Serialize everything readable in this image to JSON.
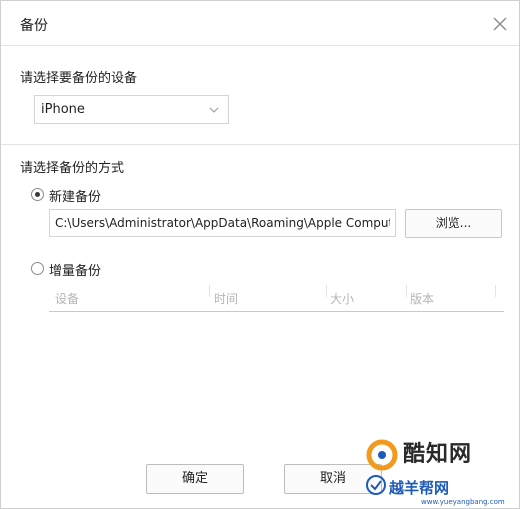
{
  "dialog": {
    "title": "备份",
    "close_icon": "close-icon"
  },
  "device_section": {
    "label": "请选择要备份的设备",
    "selected_device": "iPhone",
    "arrow_icon": "chevron-down-icon"
  },
  "method_section": {
    "label": "请选择备份的方式",
    "new_backup": {
      "label": "新建备份",
      "checked": true,
      "path_value": "C:\\Users\\Administrator\\AppData\\Roaming\\Apple Computer\\MobileSync\\Backup",
      "browse_label": "浏览..."
    },
    "incremental_backup": {
      "label": "增量备份",
      "checked": false,
      "columns": [
        "设备",
        "时间",
        "大小",
        "版本"
      ]
    }
  },
  "footer": {
    "ok_label": "确定",
    "cancel_label": "取消"
  },
  "watermark": {
    "brand1": "酷知网",
    "brand2": "越羊帮网",
    "url": "www.yueyangbang.com"
  },
  "colors": {
    "border": "#cfcfcf",
    "watermark_blue": "#1e5bb8",
    "watermark_orange": "#f39a1e"
  }
}
